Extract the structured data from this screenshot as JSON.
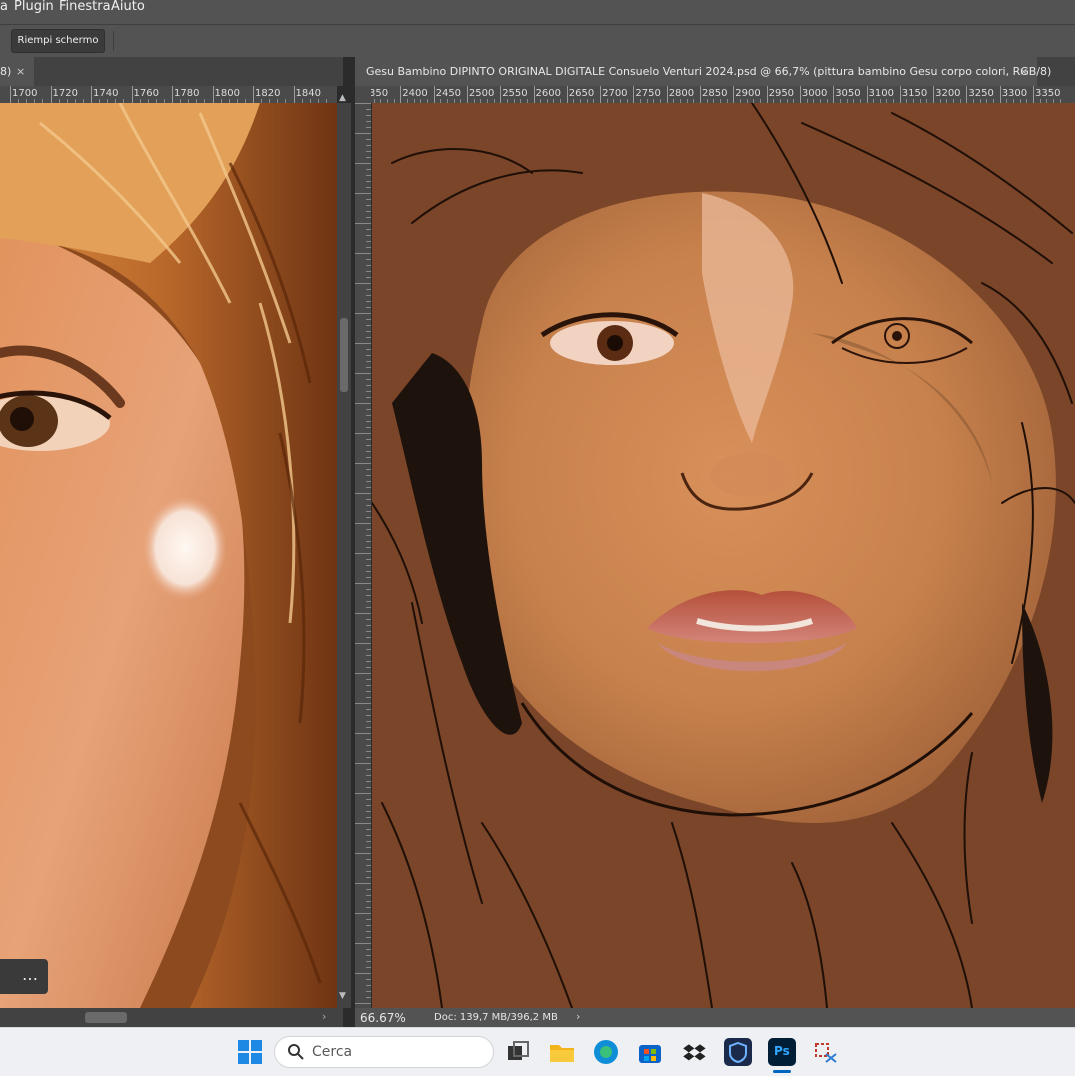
{
  "menubar": {
    "items": [
      "a",
      "Plugin",
      "Finestra",
      "Aiuto"
    ]
  },
  "options": {
    "fill_screen_label": "Riempi schermo"
  },
  "left_doc": {
    "tab_title": "8)",
    "ruler_ticks": [
      "1700",
      "1720",
      "1740",
      "1760",
      "1780",
      "1800",
      "1820",
      "1840"
    ],
    "more_icon": "…"
  },
  "right_doc": {
    "tab_title": "Gesu Bambino DIPINTO ORIGINAL DIGITALE Consuelo Venturi 2024.psd @ 66,7% (pittura bambino Gesu corpo colori, RGB/8)",
    "ruler_ticks": [
      "350",
      "2400",
      "2450",
      "2500",
      "2550",
      "2600",
      "2650",
      "2700",
      "2750",
      "2800",
      "2850",
      "2900",
      "2950",
      "3000",
      "3050",
      "3100",
      "3150",
      "3200",
      "3250",
      "3300",
      "3350"
    ],
    "zoom": "66.67%",
    "doc_info": "Doc: 139,7 MB/396,2 MB",
    "nav_arrow": "›"
  },
  "close_glyph": "×",
  "taskbar": {
    "search_placeholder": "Cerca",
    "ps_label": "Ps"
  },
  "colors": {
    "ui_panel": "#535353",
    "ui_dark": "#2b2b2b",
    "canvas_bg": "#7a4528",
    "ps_blue": "#001e36"
  }
}
